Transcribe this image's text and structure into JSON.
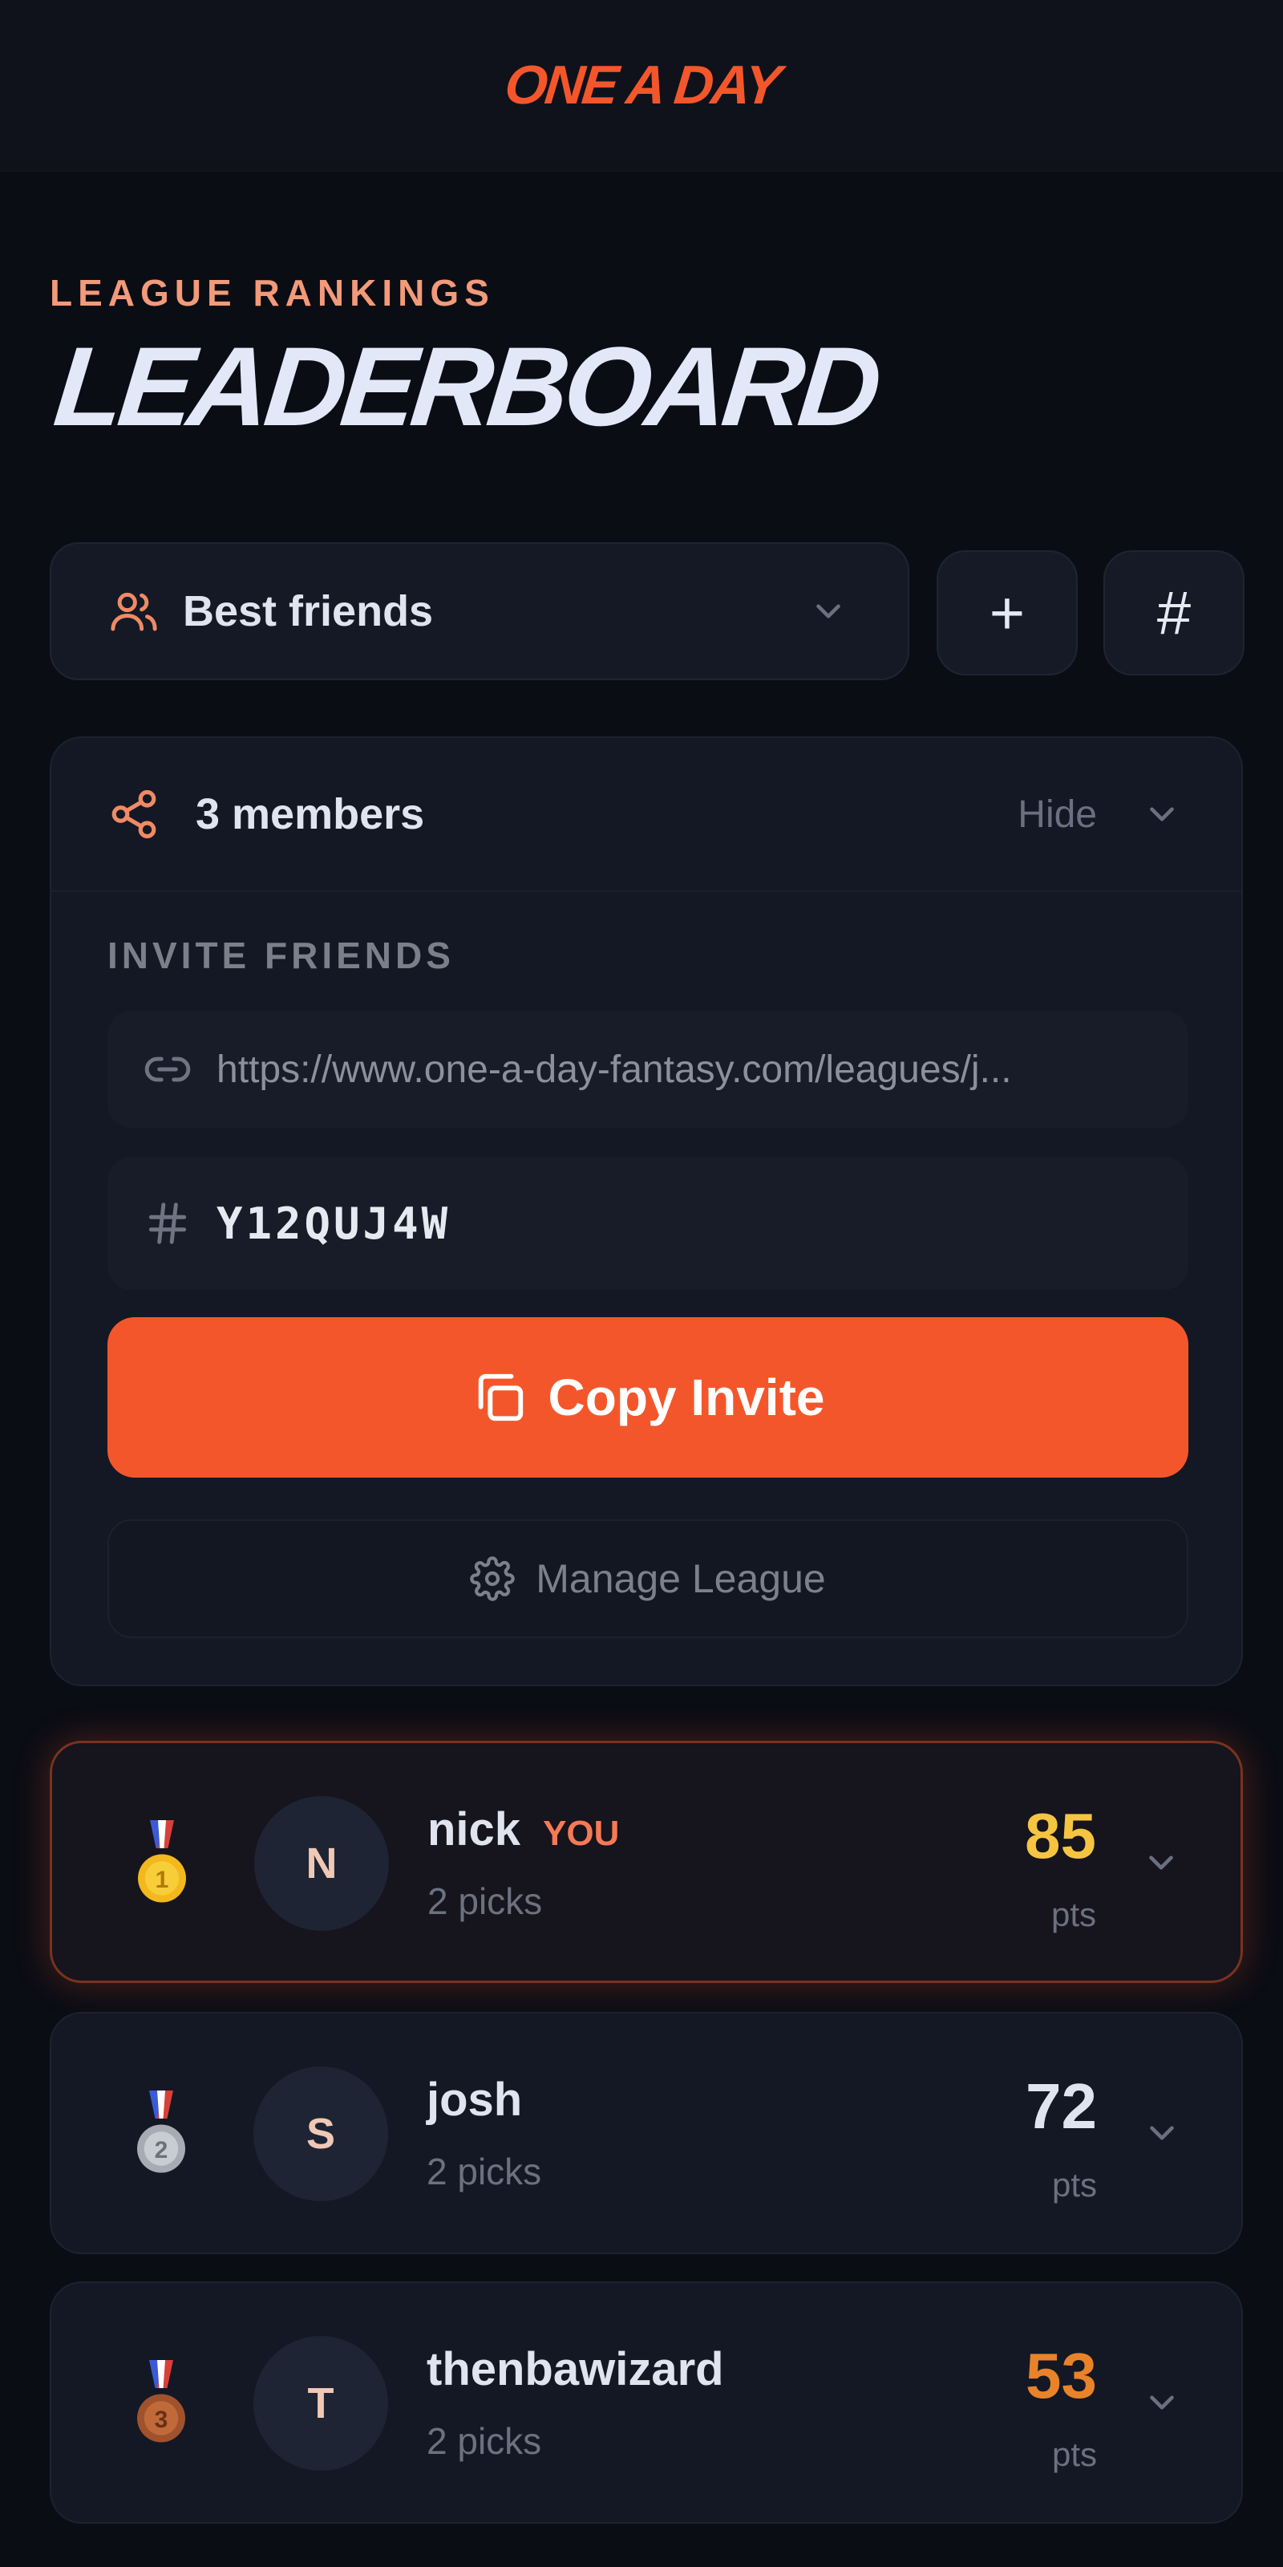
{
  "brand": "ONE A DAY",
  "header": {
    "eyebrow": "LEAGUE RANKINGS",
    "title": "LEADERBOARD"
  },
  "league_selector": {
    "icon": "users-icon",
    "selected": "Best friends"
  },
  "actions": {
    "create": "+",
    "join": "#"
  },
  "league_panel": {
    "members_label": "3 members",
    "toggle_label": "Hide",
    "invite_heading": "INVITE FRIENDS",
    "invite_link": "https://www.one-a-day-fantasy.com/leagues/j...",
    "invite_code": "Y12QUJ4W",
    "copy_button": "Copy Invite",
    "manage_button": "Manage League"
  },
  "leaderboard": [
    {
      "rank": 1,
      "medal": "gold-medal-icon",
      "initial": "N",
      "name": "nick",
      "badge": "YOU",
      "picks": "2 picks",
      "points": "85",
      "points_label": "pts",
      "points_color": "#f5c542"
    },
    {
      "rank": 2,
      "medal": "silver-medal-icon",
      "initial": "S",
      "name": "josh",
      "badge": "",
      "picks": "2 picks",
      "points": "72",
      "points_label": "pts",
      "points_color": "#dfe4ef"
    },
    {
      "rank": 3,
      "medal": "bronze-medal-icon",
      "initial": "T",
      "name": "thenbawizard",
      "badge": "",
      "picks": "2 picks",
      "points": "53",
      "points_label": "pts",
      "points_color": "#e8832a"
    }
  ],
  "colors": {
    "accent": "#f4562b",
    "background": "#0b0d14",
    "card": "#131824"
  }
}
